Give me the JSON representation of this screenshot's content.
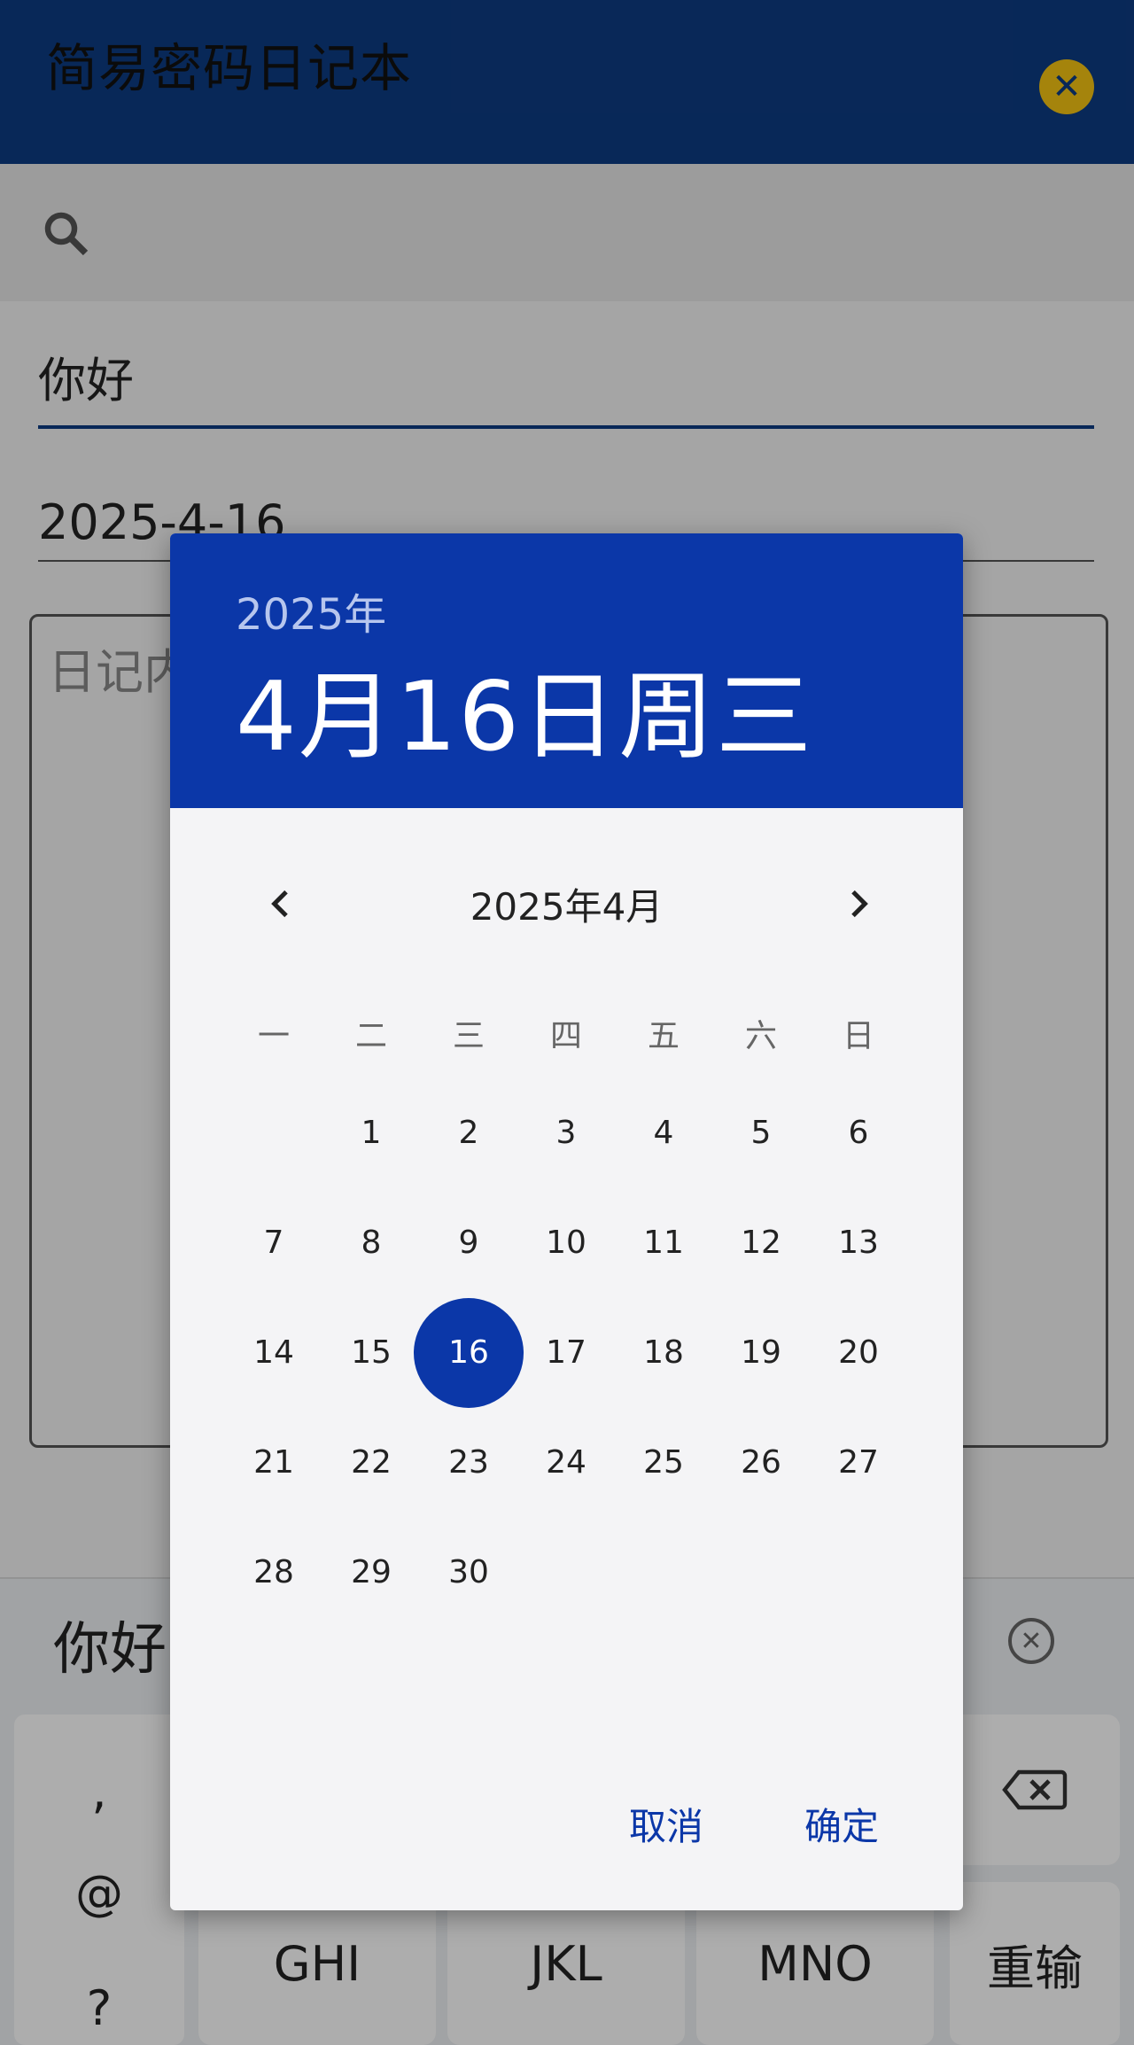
{
  "app": {
    "title": "简易密码日记本",
    "title_field": "你好",
    "date_field": "2025-4-16",
    "content_placeholder": "日记内容"
  },
  "dialog": {
    "year_label": "2025年",
    "selected_label": "4月16日周三",
    "month_label": "2025年4月",
    "weekdays": [
      "一",
      "二",
      "三",
      "四",
      "五",
      "六",
      "日"
    ],
    "days": [
      "1",
      "2",
      "3",
      "4",
      "5",
      "6",
      "7",
      "8",
      "9",
      "10",
      "11",
      "12",
      "13",
      "14",
      "15",
      "16",
      "17",
      "18",
      "19",
      "20",
      "21",
      "22",
      "23",
      "24",
      "25",
      "26",
      "27",
      "28",
      "29",
      "30"
    ],
    "first_weekday_index": 1,
    "selected_day": 16,
    "cancel_label": "取消",
    "ok_label": "确定"
  },
  "keyboard": {
    "candidate": "你好",
    "symbols": [
      ",",
      "@",
      "?"
    ],
    "keys": [
      "GHI",
      "JKL",
      "MNO",
      "重输"
    ]
  },
  "colors": {
    "appbar": "#0d3b82",
    "accent": "#0b37a8",
    "close_icon_bg": "#f3c313"
  }
}
